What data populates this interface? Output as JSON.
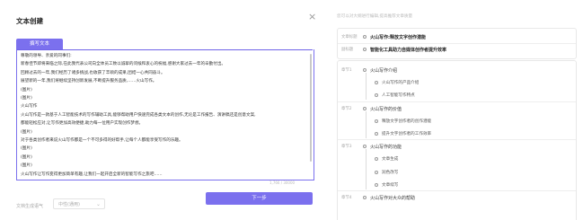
{
  "dialog": {
    "title": "文本创建",
    "close_icon": "×",
    "tab_label": "撰写文本",
    "editor_lines": [
      "尊敬的领导、亲爱的同事们:",
      "新春佳节即将来临之际,在此我代表公司向全体员工致以诚挚的问候和衷心的祝福,感谢大家过去一年的辛勤付出。",
      "回顾过去的一年,我们经历了诸多挑战,也收获了丰硕的成果,团结一心共同奋斗。",
      "展望新的一年,我们将继续坚持创新发展,不断提升服务品质,……火山写作。",
      "(图片)",
      "(图片)",
      "火山写作",
      "火山写作是一款基于人工智能技术的写作辅助工具,能够帮助用户快速完成各类文本的创作,无论是工作报告、演讲稿还是创意文案,",
      "都能轻松应对,让写作更加高效便捷,助力每一位用户实现创作梦想。",
      "(图片)",
      "对于各类创作者来说火山写作都是一个不可多得的好帮手,让每个人都能享受写作的乐趣。",
      "(图片)",
      "(图片)",
      "(图片)",
      "火山写作让写作变得更加简单有趣,让我们一起开启全新的智能写作之旅吧……"
    ],
    "char_count": "1,766 / 30000",
    "style_label": "文档生成语气",
    "style_value": "中性(通用)",
    "next_button": "下一步"
  },
  "outline": {
    "hint": "您可以对大纲进行编辑,提高推荐文章质量",
    "top_rows": [
      {
        "label": "文章标题",
        "text": "火山写作:释放文字创作潜能"
      },
      {
        "label": "副标题",
        "text": "智能化工具助力自媒体创作者提升效率"
      }
    ],
    "sections": [
      {
        "label": "章节1",
        "title": "火山写作介绍",
        "items": [
          "火山写作的产品介绍",
          "人工智能写作特点"
        ]
      },
      {
        "label": "章节2",
        "title": "火山写作的价值",
        "items": [
          "释放文字创作者的创作潜能",
          "提升文字创作者的工作效率"
        ]
      },
      {
        "label": "章节3",
        "title": "火山写作的功能",
        "items": [
          "文章生成",
          "润色改写",
          "文章续写"
        ]
      },
      {
        "label": "章节4",
        "title": "火山写作对大众的帮助",
        "items": []
      }
    ]
  }
}
